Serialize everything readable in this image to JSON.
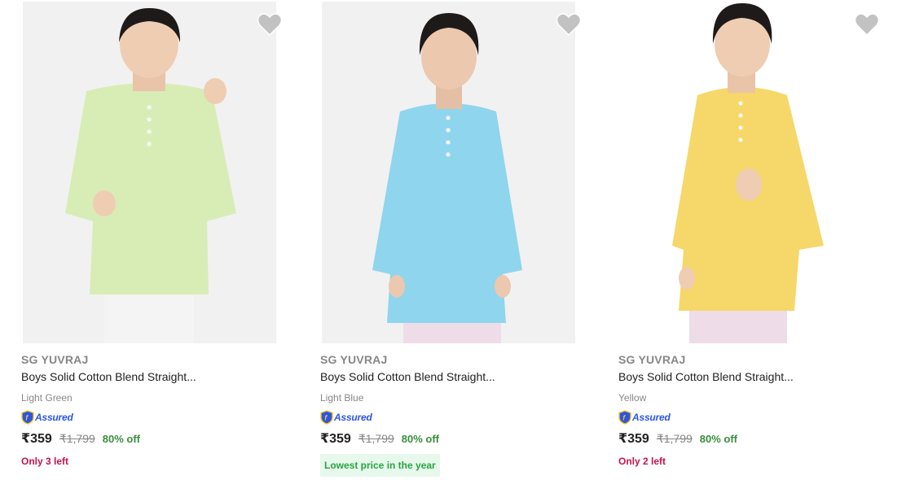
{
  "products": [
    {
      "brand": "SG YUVRAJ",
      "title": "Boys Solid Cotton Blend Straight...",
      "color_name": "Light Green",
      "assured_label": "Assured",
      "price": "₹359",
      "mrp": "₹1,799",
      "discount": "80% off",
      "stock_note": "Only 3 left",
      "kurta_color": "#d8edb6",
      "image_icon": "kid-kurta-image",
      "wishlist_icon": "heart-icon"
    },
    {
      "brand": "SG YUVRAJ",
      "title": "Boys Solid Cotton Blend Straight...",
      "color_name": "Light Blue",
      "assured_label": "Assured",
      "price": "₹359",
      "mrp": "₹1,799",
      "discount": "80% off",
      "badge": "Lowest price in the year",
      "kurta_color": "#8fd5ee",
      "image_icon": "kid-kurta-image",
      "wishlist_icon": "heart-icon"
    },
    {
      "brand": "SG YUVRAJ",
      "title": "Boys Solid Cotton Blend Straight...",
      "color_name": "Yellow",
      "assured_label": "Assured",
      "price": "₹359",
      "mrp": "₹1,799",
      "discount": "80% off",
      "stock_note": "Only 2 left",
      "kurta_color": "#f6d769",
      "image_icon": "kid-kurta-image",
      "wishlist_icon": "heart-icon"
    }
  ],
  "colors": {
    "discount_green": "#388e3c",
    "stock_red": "#c6144a",
    "assured_blue": "#2a55e5",
    "badge_bg": "#e7f8ec",
    "badge_text": "#26a541"
  }
}
